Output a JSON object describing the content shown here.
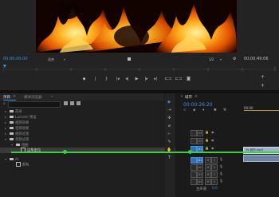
{
  "monitor": {
    "timecode_left": "00:00:00:00",
    "fit_label": "适合",
    "quality_label": "1/2",
    "timecode_right": "00:00:49:06",
    "transport": {
      "mark_in": "◆",
      "mark_out": "|",
      "clear": "}",
      "go_in": "|◂",
      "step_back": "◂|",
      "play": "▶",
      "step_fwd": "|▸",
      "go_out": "▸|",
      "insert": "⊏⊐",
      "overwrite": "⊏⊐",
      "export_frame": "◙",
      "add": "+",
      "add2": "+"
    }
  },
  "project": {
    "tab_project": "项目",
    "tab_close": "≡",
    "tab_media": "媒体浏览器",
    "tab_more": "»",
    "search_placeholder": "",
    "path_label": "城市",
    "rows": [
      {
        "label": "花朵",
        "indent": 0,
        "kind": "folder"
      },
      {
        "label": "Lumetri 预设",
        "indent": 0,
        "kind": "folder"
      },
      {
        "label": "视频效果",
        "indent": 0,
        "kind": "folder"
      },
      {
        "label": "音频效果",
        "indent": 0,
        "kind": "folder"
      },
      {
        "label": "视频过渡",
        "indent": 0,
        "kind": "folder"
      },
      {
        "label": "音频过渡",
        "indent": 0,
        "kind": "folder"
      },
      {
        "label": "扭曲",
        "indent": 1,
        "kind": "folder"
      },
      {
        "label": "边角定位",
        "indent": 2,
        "kind": "item"
      },
      {
        "label": "",
        "indent": 0,
        "kind": "blank"
      },
      {
        "label": "AI",
        "indent": 0,
        "kind": "folder"
      },
      {
        "label": "颜色",
        "indent": 1,
        "kind": "item"
      }
    ]
  },
  "timeline": {
    "tab_label": "城市",
    "timecode": "00:00:26:20",
    "ruler_label": "00:00",
    "tracks": [
      "V3",
      "V2",
      "V1",
      "A1",
      "A2",
      "A3",
      "A4"
    ],
    "master_label": "主声道",
    "master_value": "0.0",
    "clip_label": "fx 城市.mp4"
  },
  "colors": {
    "accent": "#3f8fe0",
    "track_on": "#2f6fb5",
    "green_line": "#3ad045"
  }
}
